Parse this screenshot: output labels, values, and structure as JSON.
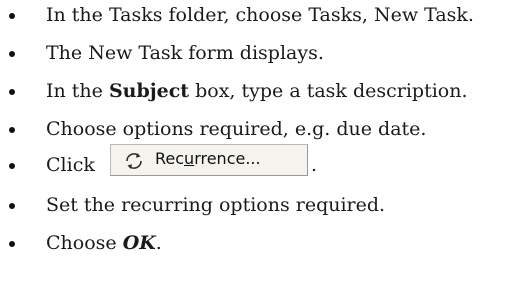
{
  "steps": [
    {
      "text": "In the Tasks folder, choose Tasks, New Task."
    },
    {
      "text": "The New Task form displays."
    },
    {
      "pre": "In the ",
      "bold": "Subject",
      "post": " box, type a task description."
    },
    {
      "text": "Choose options required, e.g. due date."
    },
    {
      "pre": "Click",
      "post": "."
    },
    {
      "text": "Set the recurring options required."
    },
    {
      "pre": "Choose ",
      "bold_italic": "OK",
      "post": "."
    }
  ],
  "recurrence_button": {
    "label_pre": "Rec",
    "label_underlined": "u",
    "label_post": "rrence...",
    "icon": "recurrence-arrows-icon"
  }
}
